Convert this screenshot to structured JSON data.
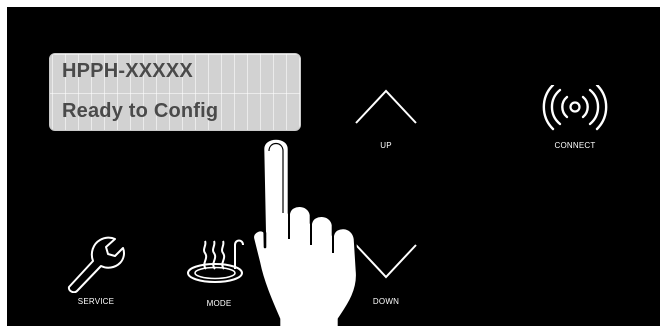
{
  "display": {
    "line1": "HPPH-XXXXX",
    "line2": "Ready to Config"
  },
  "buttons": {
    "up": {
      "label": "UP",
      "icon": "chevron-up-icon"
    },
    "down": {
      "label": "DOWN",
      "icon": "chevron-down-icon"
    },
    "connect": {
      "label": "CONNECT",
      "icon": "wireless-icon"
    },
    "service": {
      "label": "SERVICE",
      "icon": "wrench-icon"
    },
    "mode": {
      "label": "MODE",
      "icon": "hot-tub-icon"
    }
  },
  "colors": {
    "panel_background": "#000000",
    "lcd_background": "#d2d2d2",
    "lcd_text": "#4a4a4a",
    "icon_stroke": "#ffffff"
  }
}
